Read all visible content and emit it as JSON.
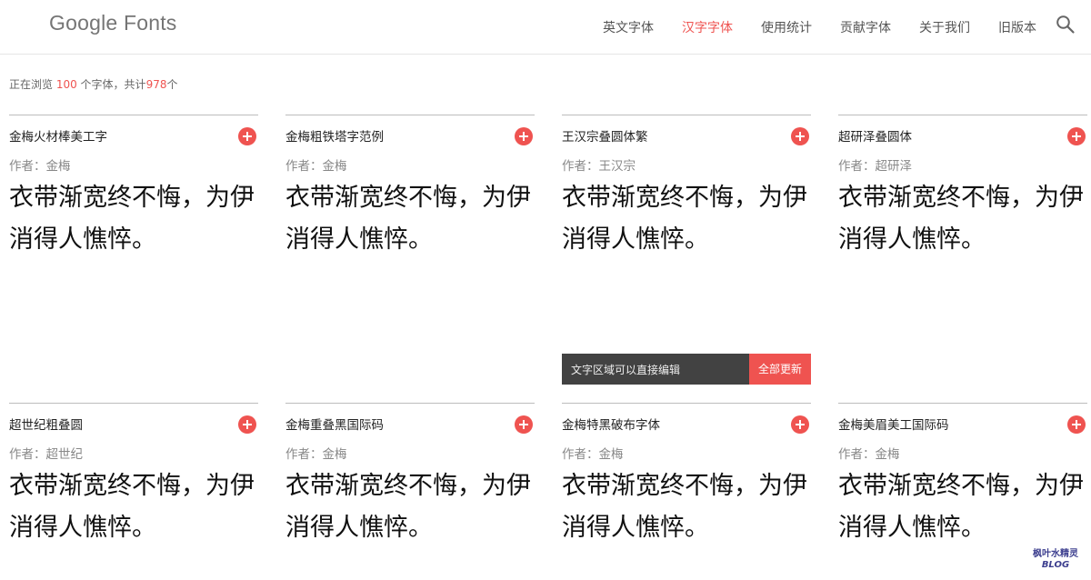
{
  "header": {
    "logo": "Google Fonts",
    "nav": [
      "英文字体",
      "汉字字体",
      "使用统计",
      "贡献字体",
      "关于我们",
      "旧版本"
    ],
    "active_nav": "汉字字体",
    "search_icon": "search-icon"
  },
  "status": {
    "prefix": "正在浏览 ",
    "showing": "100",
    "middle": " 个字体，共计",
    "total": "978",
    "suffix": "个"
  },
  "cards": [
    {
      "name": "金梅火材棒美工字",
      "author": "作者：金梅",
      "sample": "衣带渐宽终不悔，为伊消得人憔悴。"
    },
    {
      "name": "金梅粗铁塔字范例",
      "author": "作者：金梅",
      "sample": "衣带渐宽终不悔，为伊消得人憔悴。"
    },
    {
      "name": "王汉宗叠圆体繁",
      "author": "作者：王汉宗",
      "sample": "衣带渐宽终不悔，为伊消得人憔悴。"
    },
    {
      "name": "超研泽叠圆体",
      "author": "作者：超研泽",
      "sample": "衣带渐宽终不悔，为伊消得人憔悴。"
    },
    {
      "name": "超世纪粗叠圆",
      "author": "作者：超世纪",
      "sample": "衣带渐宽终不悔，为伊消得人憔悴。"
    },
    {
      "name": "金梅重叠黑国际码",
      "author": "作者：金梅",
      "sample": "衣带渐宽终不悔，为伊消得人憔悴。"
    },
    {
      "name": "金梅特黑破布字体",
      "author": "作者：金梅",
      "sample": "衣带渐宽终不悔，为伊消得人憔悴。"
    },
    {
      "name": "金梅美眉美工国际码",
      "author": "作者：金梅",
      "sample": "衣带渐宽终不悔，为伊消得人憔悴。"
    }
  ],
  "edit_bar": {
    "label": "文字区域可以直接编辑",
    "button": "全部更新"
  },
  "watermark": {
    "line1": "枫叶水精灵",
    "line2": "BLOG"
  },
  "colors": {
    "accent": "#ef5350",
    "edit_bar_bg": "#424242",
    "logo": "#757575"
  }
}
